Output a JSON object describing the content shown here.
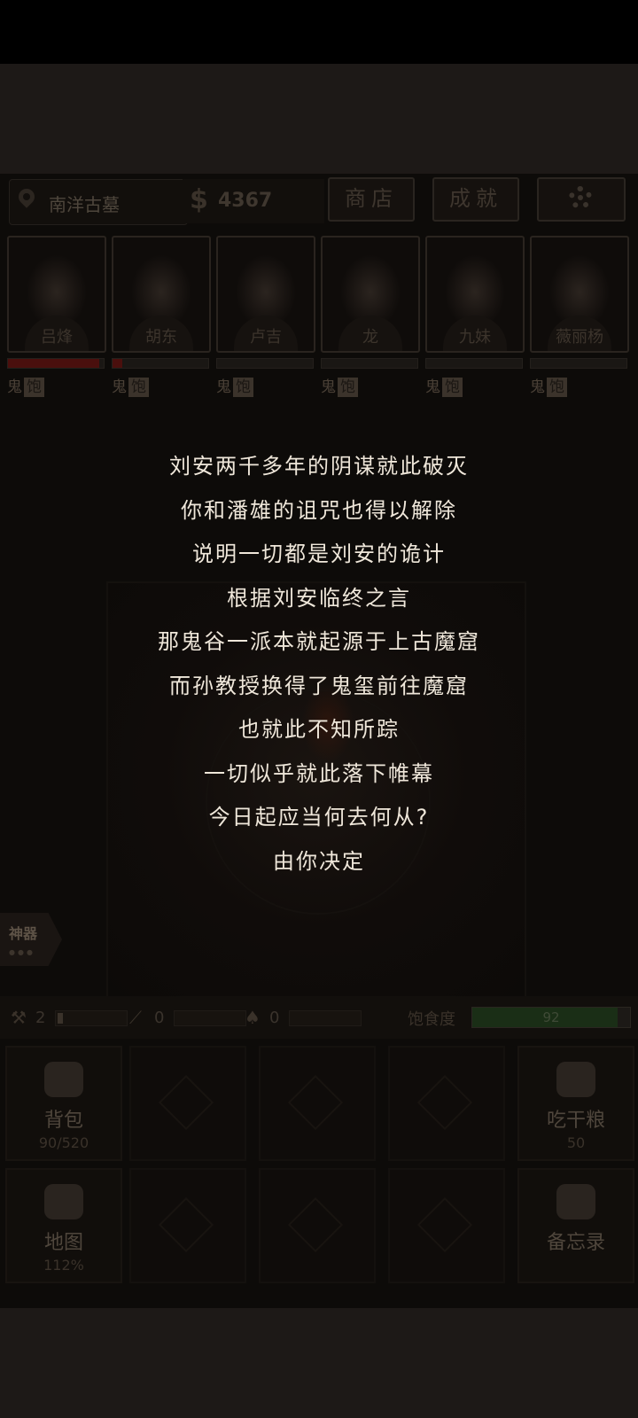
{
  "topbar": {
    "location": "南洋古墓",
    "currency_symbol": "$",
    "money": "4367",
    "shop_label": "商店",
    "achievements_label": "成就",
    "settings_icon": "gear-icon"
  },
  "characters": [
    {
      "name": "吕烽",
      "hp": 0.95,
      "badge1": "鬼",
      "badge2": "饱"
    },
    {
      "name": "胡东",
      "hp": 0.1,
      "badge1": "鬼",
      "badge2": "饱"
    },
    {
      "name": "卢吉",
      "hp": 0,
      "badge1": "鬼",
      "badge2": "饱"
    },
    {
      "name": "龙",
      "hp": 0,
      "badge1": "鬼",
      "badge2": "饱"
    },
    {
      "name": "九妹",
      "hp": 0,
      "badge1": "鬼",
      "badge2": "饱"
    },
    {
      "name": "薇丽杨",
      "hp": 0,
      "badge1": "鬼",
      "badge2": "饱"
    }
  ],
  "story": {
    "lines": [
      "刘安两千多年的阴谋就此破灭",
      "你和潘雄的诅咒也得以解除",
      "说明一切都是刘安的诡计",
      "根据刘安临终之言",
      "那鬼谷一派本就起源于上古魔窟",
      "而孙教授换得了鬼玺前往魔窟",
      "也就此不知所踪",
      "一切似乎就此落下帷幕",
      "今日起应当何去何从?",
      "由你决定"
    ]
  },
  "artifact": {
    "label": "神器"
  },
  "status": {
    "tools": [
      {
        "icon": "torch-icon",
        "count": "2"
      },
      {
        "icon": "pickaxe-icon",
        "count": "0"
      },
      {
        "icon": "shovel-icon",
        "count": "0"
      }
    ],
    "hunger_label": "饱食度",
    "hunger_value": "92",
    "hunger_level": 0.92
  },
  "panels": {
    "backpack": {
      "label": "背包",
      "sub": "90/520"
    },
    "eat": {
      "label": "吃干粮",
      "sub": "50"
    },
    "map": {
      "label": "地图",
      "sub": "112%"
    },
    "memo": {
      "label": "备忘录",
      "sub": ""
    }
  }
}
